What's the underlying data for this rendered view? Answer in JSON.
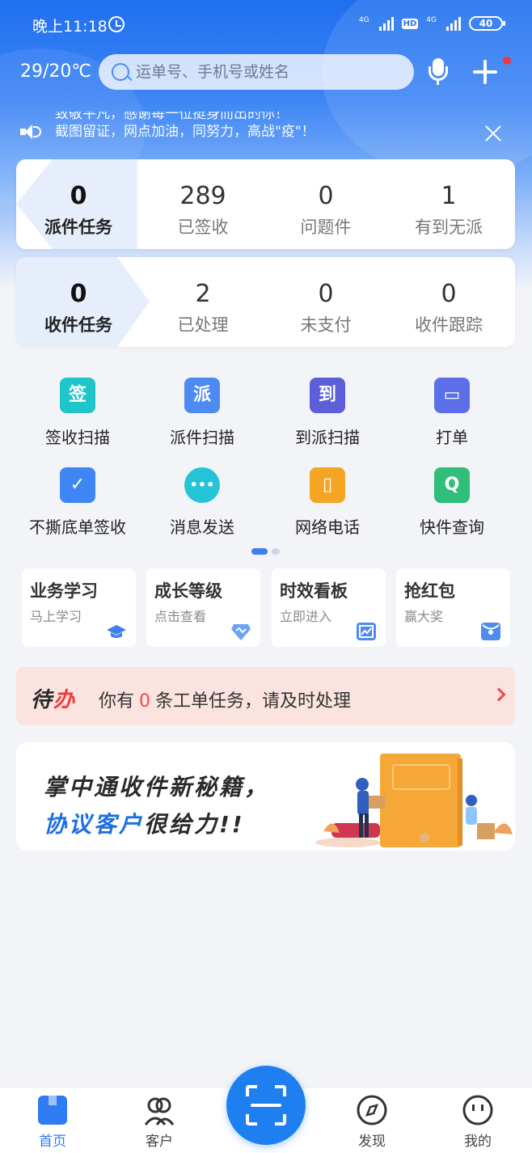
{
  "status_bar": {
    "time": "晚上11:18",
    "network_1": "4G",
    "network_2": "HD",
    "network_3": "4G",
    "battery": "40"
  },
  "header": {
    "weather": "29/20℃",
    "search_placeholder": "运单号、手机号或姓名"
  },
  "notice": {
    "line1": "致敬平凡，感谢每一位挺身而出的你！",
    "line2": "截图留证，网点加油，同努力，高战\"疫\"！"
  },
  "dispatch_stats": [
    {
      "value": "0",
      "label": "派件任务"
    },
    {
      "value": "289",
      "label": "已签收"
    },
    {
      "value": "0",
      "label": "问题件"
    },
    {
      "value": "1",
      "label": "有到无派"
    }
  ],
  "pickup_stats": [
    {
      "value": "0",
      "label": "收件任务"
    },
    {
      "value": "2",
      "label": "已处理"
    },
    {
      "value": "0",
      "label": "未支付"
    },
    {
      "value": "0",
      "label": "收件跟踪"
    }
  ],
  "grid": [
    {
      "icon": "sign-icon",
      "glyph": "签",
      "label": "签收扫描",
      "color": "#1fc6c9"
    },
    {
      "icon": "dispatch-icon",
      "glyph": "派",
      "label": "派件扫描",
      "color": "#4d8bf0"
    },
    {
      "icon": "arrive-icon",
      "glyph": "到",
      "label": "到派扫描",
      "color": "#5b5fd8"
    },
    {
      "icon": "printer-icon",
      "glyph": "▭",
      "label": "打单",
      "color": "#5b6fe8"
    },
    {
      "icon": "checkbox-icon",
      "glyph": "✓",
      "label": "不撕底单签收",
      "color": "#3f86f5"
    },
    {
      "icon": "chat-icon",
      "glyph": "•••",
      "label": "消息发送",
      "color": "#24c3d8"
    },
    {
      "icon": "phone-icon",
      "glyph": "▯",
      "label": "网络电话",
      "color": "#f5a524"
    },
    {
      "icon": "query-icon",
      "glyph": "Q",
      "label": "快件查询",
      "color": "#2fbf7a"
    }
  ],
  "mini_cards": [
    {
      "title": "业务学习",
      "sub": "马上学习",
      "icon": "graduation-cap-icon"
    },
    {
      "title": "成长等级",
      "sub": "点击查看",
      "icon": "level-icon"
    },
    {
      "title": "时效看板",
      "sub": "立即进入",
      "icon": "chart-board-icon"
    },
    {
      "title": "抢红包",
      "sub": "赢大奖",
      "icon": "red-packet-icon"
    }
  ],
  "todo": {
    "tag_a": "待",
    "tag_b": "办",
    "prefix": "你有",
    "count": "0",
    "suffix": "条工单任务，请及时处理"
  },
  "banner": {
    "line1": "掌中通收件新秘籍，",
    "line2_blue": "协议客户",
    "line2_rest": "很给力!!"
  },
  "tabs": [
    {
      "label": "首页",
      "icon": "home-icon",
      "active": true
    },
    {
      "label": "客户",
      "icon": "customers-icon",
      "active": false
    },
    {
      "label": "发现",
      "icon": "compass-icon",
      "active": false
    },
    {
      "label": "我的",
      "icon": "profile-icon",
      "active": false
    }
  ],
  "colors": {
    "primary": "#1e80f0",
    "accent_red": "#ef4a4a"
  }
}
